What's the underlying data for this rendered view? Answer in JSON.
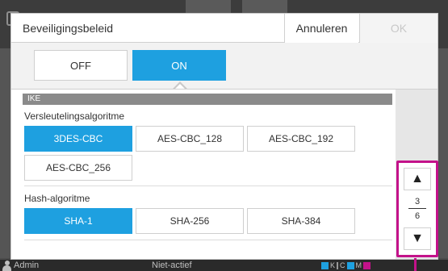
{
  "background": {
    "status": {
      "user": "Admin",
      "state": "Niet-actief",
      "ink_labels": [
        "K",
        "C",
        "M"
      ]
    }
  },
  "dialog": {
    "title": "Beveiligingsbeleid",
    "cancel_label": "Annuleren",
    "ok_label": "OK",
    "toggle": {
      "off_label": "OFF",
      "on_label": "ON",
      "selected": "ON"
    },
    "section_header": "IKE",
    "encryption": {
      "label": "Versleutelingsalgoritme",
      "options": [
        "3DES-CBC",
        "AES-CBC_128",
        "AES-CBC_192",
        "AES-CBC_256"
      ],
      "selected": "3DES-CBC"
    },
    "hash": {
      "label": "Hash-algoritme",
      "options": [
        "SHA-1",
        "SHA-256",
        "SHA-384"
      ],
      "selected": "SHA-1"
    },
    "pager": {
      "current": "3",
      "total": "6",
      "up_symbol": "▲",
      "down_symbol": "▼"
    }
  },
  "colors": {
    "accent": "#1ea0e0",
    "highlight": "#c3128a",
    "section_header": "#8a8a8a"
  }
}
